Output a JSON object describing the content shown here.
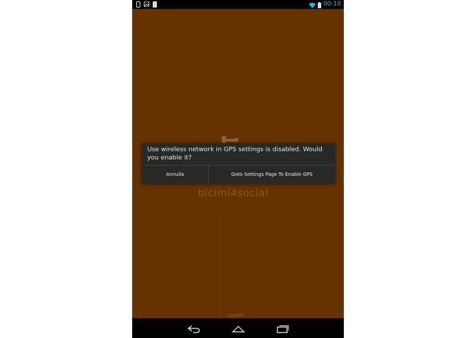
{
  "status_bar": {
    "time": "00:10",
    "left_icons": [
      "phone-notification-icon",
      "image-notification-icon",
      "sd-card-icon"
    ],
    "right_icons": [
      "wifi-icon",
      "battery-icon"
    ]
  },
  "app": {
    "background_color": "#663300",
    "watermark_text": "bicimi4social",
    "footer_text": "App4Mi"
  },
  "dialog": {
    "message": "Use wireless network in GPS settings is disabled. Would you enable it?",
    "cancel_label": "Annulla",
    "confirm_label": "Goto Settings Page To Enable GPS"
  },
  "nav_bar": {
    "buttons": [
      "back-icon",
      "home-icon",
      "recent-apps-icon"
    ]
  },
  "colors": {
    "accent": "#33b5e5",
    "dialog_bg": "#282828"
  }
}
